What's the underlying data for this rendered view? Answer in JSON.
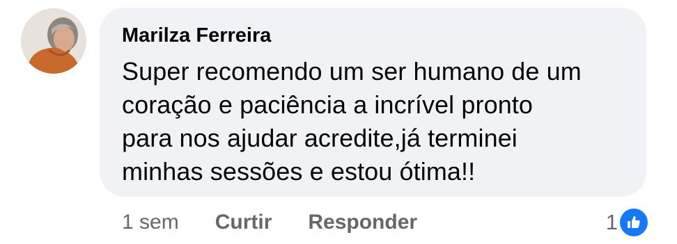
{
  "comment": {
    "author": "Marilza Ferreira",
    "text": "Super recomendo  um ser humano de um\ncoração  e paciência a incrível pronto\npara nos ajudar acredite,já terminei\nminhas sessões  e estou ótima!!",
    "time": "1 sem",
    "like_label": "Curtir",
    "reply_label": "Responder",
    "reaction_count": "1",
    "reaction_icon": "thumbs-up-icon"
  },
  "colors": {
    "bubble": "#f0f2f5",
    "secondary_text": "#65676b",
    "like_blue": "#1877f2"
  }
}
